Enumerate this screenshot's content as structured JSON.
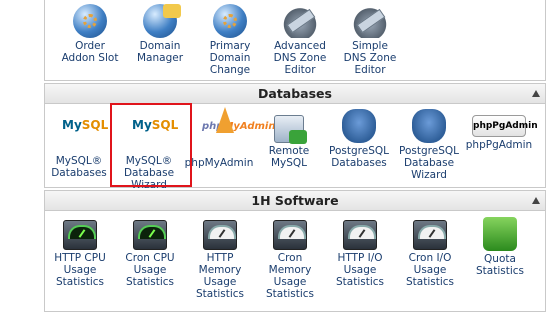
{
  "top_section": {
    "items": [
      {
        "label": "Order\nAddon Slot",
        "icon": "order-addon-slot-icon"
      },
      {
        "label": "Domain\nManager",
        "icon": "domain-manager-icon"
      },
      {
        "label": "Primary\nDomain\nChange",
        "icon": "primary-domain-change-icon"
      },
      {
        "label": "Advanced\nDNS Zone\nEditor",
        "icon": "advanced-dns-zone-editor-icon"
      },
      {
        "label": "Simple\nDNS Zone\nEditor",
        "icon": "simple-dns-zone-editor-icon"
      }
    ]
  },
  "databases": {
    "title": "Databases",
    "items": [
      {
        "label": "MySQL®\nDatabases",
        "icon": "mysql-icon"
      },
      {
        "label": "MySQL®\nDatabase\nWizard",
        "icon": "mysql-wizard-icon"
      },
      {
        "label": "phpMyAdmin",
        "icon": "phpmyadmin-icon"
      },
      {
        "label": "Remote\nMySQL",
        "icon": "remote-mysql-icon"
      },
      {
        "label": "PostgreSQL\nDatabases",
        "icon": "postgresql-icon"
      },
      {
        "label": "PostgreSQL\nDatabase\nWizard",
        "icon": "postgresql-wizard-icon"
      },
      {
        "label": "phpPgAdmin",
        "icon": "phppgadmin-icon"
      }
    ],
    "logo_text": {
      "mysql_a": "My",
      "mysql_b": "SQL",
      "php": "php",
      "myadmin": "MyAdmin",
      "pgadmin": "phpPgAdmin"
    }
  },
  "software": {
    "title": "1H Software",
    "items": [
      {
        "label": "HTTP CPU\nUsage\nStatistics",
        "icon": "http-cpu-gauge-icon"
      },
      {
        "label": "Cron CPU\nUsage\nStatistics",
        "icon": "cron-cpu-gauge-icon"
      },
      {
        "label": "HTTP\nMemory\nUsage\nStatistics",
        "icon": "http-memory-gauge-icon"
      },
      {
        "label": "Cron\nMemory\nUsage\nStatistics",
        "icon": "cron-memory-gauge-icon"
      },
      {
        "label": "HTTP I/O\nUsage\nStatistics",
        "icon": "http-io-gauge-icon"
      },
      {
        "label": "Cron I/O\nUsage\nStatistics",
        "icon": "cron-io-gauge-icon"
      },
      {
        "label": "Quota\nStatistics",
        "icon": "quota-icon"
      }
    ]
  },
  "colors": {
    "highlight": "#e0141b",
    "label": "#1a3d6e",
    "panel_border": "#c9c9c9"
  }
}
